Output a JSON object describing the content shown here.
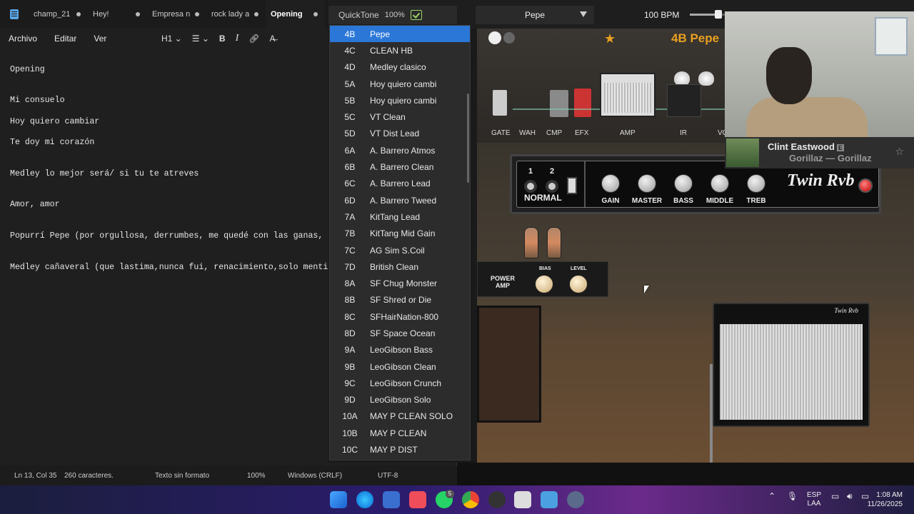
{
  "notepad": {
    "tabs": [
      {
        "label": "champ_21",
        "active": false
      },
      {
        "label": "Hey!",
        "active": false
      },
      {
        "label": "Empresa n",
        "active": false
      },
      {
        "label": "rock lady a",
        "active": false
      },
      {
        "label": "Opening",
        "active": true
      }
    ],
    "menu": [
      "Archivo",
      "Editar",
      "Ver"
    ],
    "format_heading": "H1",
    "lines": [
      "Opening",
      "",
      "Mi consuelo",
      "Hoy quiero cambiar",
      "Te doy mi corazón",
      "",
      "Medley lo mejor será/ si tu te atreves",
      "",
      "Amor, amor",
      "",
      "Popurrí Pepe (por orgullosa, derrumbes, me quedé con las ganas, te",
      "",
      "Medley cañaveral (que lastima,nunca fui, renacimiento,solo mentiras"
    ],
    "status": {
      "position": "Ln 13, Col 35",
      "chars": "260 caracteres.",
      "format": "Texto sin formato",
      "zoom": "100%",
      "line_ending": "Windows (CRLF)",
      "encoding": "UTF-8"
    }
  },
  "amp": {
    "quicktone": "QuickTone",
    "quicktone_pct": "100%",
    "preset_name": "Pepe",
    "bpm": "100 BPM",
    "bpm_level": 0.8,
    "title": "4B Pepe",
    "chain_labels": [
      "GATE",
      "WAH",
      "CMP",
      "EFX",
      "AMP",
      "IR",
      "VO"
    ],
    "presets": [
      {
        "code": "4B",
        "name": "Pepe",
        "selected": true
      },
      {
        "code": "4C",
        "name": "CLEAN HB"
      },
      {
        "code": "4D",
        "name": "Medley clasico"
      },
      {
        "code": "5A",
        "name": "Hoy quiero cambi"
      },
      {
        "code": "5B",
        "name": "Hoy quiero cambi"
      },
      {
        "code": "5C",
        "name": "VT Clean"
      },
      {
        "code": "5D",
        "name": "VT Dist Lead"
      },
      {
        "code": "6A",
        "name": "A. Barrero Atmos"
      },
      {
        "code": "6B",
        "name": "A. Barrero Clean"
      },
      {
        "code": "6C",
        "name": "A. Barrero Lead"
      },
      {
        "code": "6D",
        "name": "A. Barrero Tweed"
      },
      {
        "code": "7A",
        "name": "KitTang Lead"
      },
      {
        "code": "7B",
        "name": "KitTang Mid Gain"
      },
      {
        "code": "7C",
        "name": "AG Sim S.Coil"
      },
      {
        "code": "7D",
        "name": "British Clean"
      },
      {
        "code": "8A",
        "name": "SF Chug Monster"
      },
      {
        "code": "8B",
        "name": "SF Shred or Die"
      },
      {
        "code": "8C",
        "name": "SFHairNation-800"
      },
      {
        "code": "8D",
        "name": "SF Space Ocean"
      },
      {
        "code": "9A",
        "name": "LeoGibson Bass"
      },
      {
        "code": "9B",
        "name": "LeoGibson Clean"
      },
      {
        "code": "9C",
        "name": "LeoGibson Crunch"
      },
      {
        "code": "9D",
        "name": "LeoGibson Solo"
      },
      {
        "code": "10A",
        "name": "MAY P CLEAN SOLO"
      },
      {
        "code": "10B",
        "name": "MAY P CLEAN"
      },
      {
        "code": "10C",
        "name": "MAY P DIST"
      }
    ],
    "head": {
      "ch1": "1",
      "ch2": "2",
      "channel_label": "NORMAL",
      "knobs": [
        "GAIN",
        "MASTER",
        "BASS",
        "MIDDLE",
        "TREB"
      ],
      "logo": "Twin Rvb"
    },
    "power": {
      "label_1": "POWER",
      "label_2": "AMP",
      "bias": "BIAS",
      "level": "LEVEL"
    },
    "cab_logo": "Twin Rvb"
  },
  "now_playing": {
    "track": "Clint Eastwood",
    "badge": "E",
    "artist": "Gorillaz — Gorillaz"
  },
  "taskbar": {
    "whatsapp_badge": "5",
    "lang_1": "ESP",
    "lang_2": "LAA",
    "time": "1:08 AM",
    "date": "11/26/2025"
  },
  "colors": {
    "accent": "#2b77d8",
    "preset_title": "#e8a020"
  }
}
